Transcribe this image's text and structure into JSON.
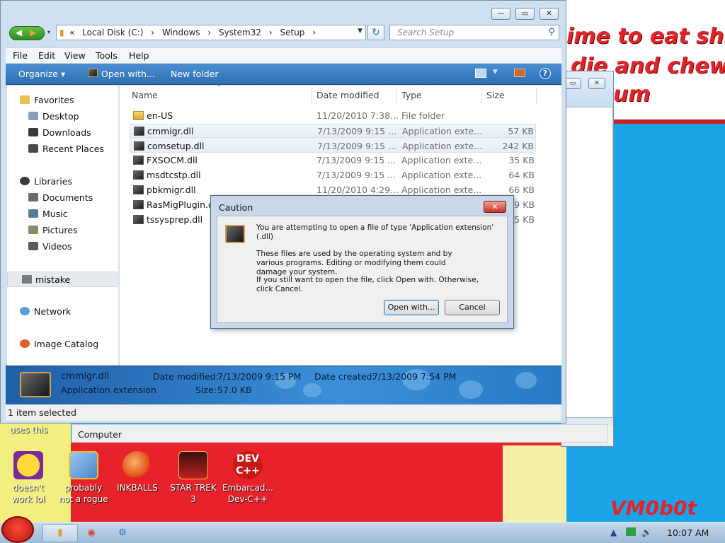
{
  "desktop": {
    "graffiti_lines": [
      "ime to eat shit",
      "die and chew",
      "um"
    ],
    "signature": "VM0b0t",
    "partial_label": "uses this",
    "icons": [
      {
        "label_1": "doesn't",
        "label_2": "work lol",
        "icon": "yahoo-messenger-icon"
      },
      {
        "label_1": "probably",
        "label_2": "not a rogue",
        "icon": "program-gear-icon"
      },
      {
        "label_1": "INKBALLS",
        "label_2": "",
        "icon": "inkball-icon"
      },
      {
        "label_1": "STAR TREK",
        "label_2": "3",
        "icon": "star-trek-game-icon"
      },
      {
        "label_1": "Embarcad...",
        "label_2": "Dev-C++",
        "icon": "devcpp-icon"
      }
    ]
  },
  "back_window": {
    "status": "Computer"
  },
  "explorer": {
    "address": [
      "«",
      "Local Disk (C:)",
      "›",
      "Windows",
      "›",
      "System32",
      "›",
      "Setup",
      "›"
    ],
    "search_placeholder": "Search Setup",
    "menu": [
      "File",
      "Edit",
      "View",
      "Tools",
      "Help"
    ],
    "commands": {
      "organize": "Organize ▾",
      "open_with": "Open with...",
      "new_folder": "New folder"
    },
    "nav": {
      "favorites": "Favorites",
      "desktop": "Desktop",
      "downloads": "Downloads",
      "recent": "Recent Places",
      "libraries": "Libraries",
      "documents": "Documents",
      "music": "Music",
      "pictures": "Pictures",
      "videos": "Videos",
      "mistake": "mistake",
      "network": "Network",
      "image_catalog": "Image Catalog"
    },
    "columns": {
      "name": "Name",
      "date": "Date modified",
      "type": "Type",
      "size": "Size"
    },
    "files": [
      {
        "name": "en-US",
        "date": "11/20/2010 7:38...",
        "type": "File folder",
        "size": ""
      },
      {
        "name": "cmmigr.dll",
        "date": "7/13/2009 9:15 ...",
        "type": "Application exte...",
        "size": "57 KB"
      },
      {
        "name": "comsetup.dll",
        "date": "7/13/2009 9:15 ...",
        "type": "Application exte...",
        "size": "242 KB"
      },
      {
        "name": "FXSOCM.dll",
        "date": "7/13/2009 9:15 ...",
        "type": "Application exte...",
        "size": "35 KB"
      },
      {
        "name": "msdtcstp.dll",
        "date": "7/13/2009 9:15 ...",
        "type": "Application exte...",
        "size": "64 KB"
      },
      {
        "name": "pbkmigr.dll",
        "date": "11/20/2010 4:29...",
        "type": "Application exte...",
        "size": "66 KB"
      },
      {
        "name": "RasMigPlugin.dll",
        "date": "",
        "type": "",
        "size": "9 KB"
      },
      {
        "name": "tssysprep.dll",
        "date": "",
        "type": "",
        "size": "5 KB"
      }
    ],
    "details": {
      "name": "cmmigr.dll",
      "kind": "Application extension",
      "modified_label": "Date modified:",
      "modified": "7/13/2009 9:15 PM",
      "created_label": "Date created:",
      "created": "7/13/2009 7:54 PM",
      "size_label": "Size:",
      "size": "57.0 KB"
    },
    "status": "1 item selected"
  },
  "dialog": {
    "title": "Caution",
    "line1": "You are attempting to open a file of type 'Application extension' (.dll)",
    "line2": "These files are used by the operating system and by various programs. Editing or modifying them could damage your system.",
    "line3": "If you still want to open the file, click Open with. Otherwise, click Cancel.",
    "open_with": "Open with...",
    "cancel": "Cancel"
  },
  "taskbar": {
    "clock": "10:07 AM"
  }
}
